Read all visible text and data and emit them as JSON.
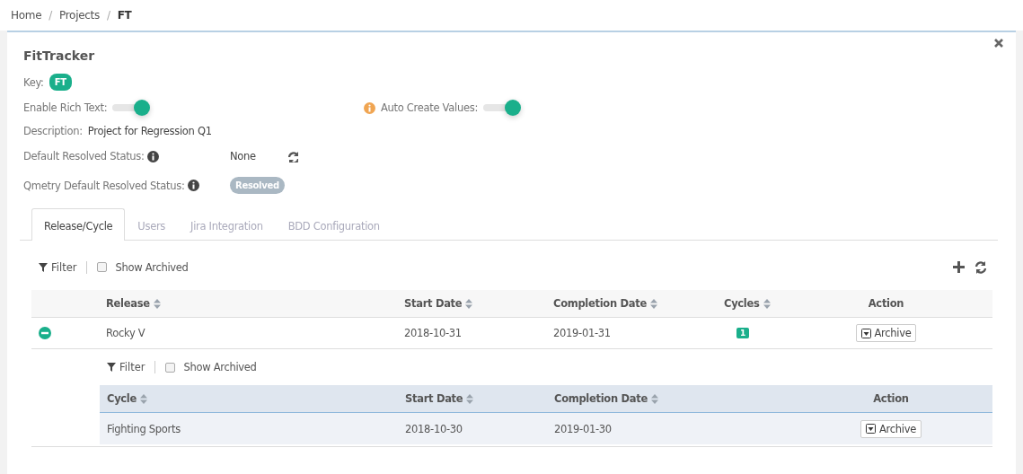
{
  "breadcrumb": [
    {
      "label": "Home",
      "current": false
    },
    {
      "separator": "/",
      "label": "Projects",
      "current": false
    },
    {
      "separator": "/",
      "label": "FT",
      "current": true
    }
  ],
  "project": {
    "title": "FitTracker",
    "key_label": "Key:",
    "key": "FT",
    "rich_text": {
      "label": "Enable Rich Text:",
      "on": true
    },
    "auto_create": {
      "label": "Auto Create Values:",
      "on": true
    },
    "description_label": "Description:",
    "description": "Project for Regression Q1",
    "default_status_label": "Default Resolved Status:",
    "default_status": "None",
    "qmetry_status_label": "Qmetry Default Resolved Status:",
    "qmetry_status": "Resolved"
  },
  "tabs": [
    {
      "label": "Release/Cycle",
      "selected": true
    },
    {
      "label": "Users",
      "selected": false
    },
    {
      "label": "Jira Integration",
      "selected": false
    },
    {
      "label": "BDD Configuration",
      "selected": false
    }
  ],
  "toolbar": {
    "filter": "Filter",
    "show_archived": {
      "label": "Show Archived",
      "checked": false
    }
  },
  "releases": {
    "columns": [
      {
        "label": "Release",
        "sortable": true
      },
      {
        "label": "Start Date",
        "sortable": true
      },
      {
        "label": "Completion Date",
        "sortable": true
      },
      {
        "label": "Cycles",
        "sortable": true
      },
      {
        "label": "Action",
        "sortable": false
      }
    ],
    "rows": [
      {
        "expanded": true,
        "release": "Rocky V",
        "start": "2018-10-31",
        "completion": "2019-01-31",
        "cycles": "1",
        "action": "Archive",
        "cycle_toolbar": {
          "filter": "Filter",
          "show_archived": {
            "label": "Show Archived",
            "checked": false
          }
        },
        "cycle_columns": [
          {
            "label": "Cycle",
            "sortable": true
          },
          {
            "label": "Start Date",
            "sortable": true
          },
          {
            "label": "Completion Date",
            "sortable": true
          },
          {
            "label": "Action",
            "sortable": false
          }
        ],
        "cycle_rows": [
          {
            "cycle": "Fighting Sports",
            "start": "2018-10-30",
            "completion": "2019-01-30",
            "action": "Archive"
          }
        ]
      }
    ]
  }
}
